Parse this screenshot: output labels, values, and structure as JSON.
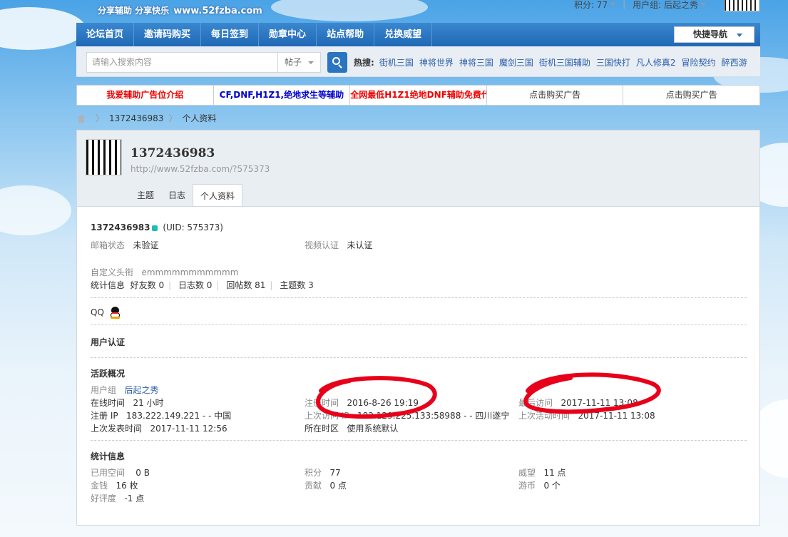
{
  "header": {
    "logo_tagline": "分享辅助  分享快乐",
    "logo_site": "www.52fzba.com",
    "points_label": "积分: 77",
    "usergroup_label": "用户组: 后起之秀"
  },
  "nav": {
    "items": [
      "论坛首页",
      "邀请码购买",
      "每日签到",
      "勋章中心",
      "站点帮助",
      "兑换威望"
    ],
    "quick_nav": "快捷导航"
  },
  "search": {
    "placeholder": "请输入搜索内容",
    "type": "帖子",
    "hot_label": "热搜:",
    "hot_keywords": [
      "街机三国",
      "神将世界",
      "神将三国",
      "魔剑三国",
      "街机三国辅助",
      "三国快打",
      "凡人修真2",
      "冒险契约",
      "醉西游"
    ]
  },
  "ads": [
    {
      "text": "我爱辅助广告位介绍",
      "style": "red"
    },
    {
      "text": "CF,DNF,H1Z1,绝地求生等辅助",
      "style": "blue"
    },
    {
      "text": "全网最低H1Z1绝地DNF辅助免费代",
      "style": "red"
    },
    {
      "text": "点击购买广告",
      "style": "plain"
    },
    {
      "text": "点击购买广告",
      "style": "plain"
    }
  ],
  "breadcrumb": {
    "user": "1372436983",
    "page": "个人资料"
  },
  "profile": {
    "username": "1372436983",
    "url": "http://www.52fzba.com/?575373",
    "tabs": [
      "主题",
      "日志",
      "个人资料"
    ],
    "active_tab": "个人资料",
    "uid_text": "(UID: 575373)",
    "email_label": "邮箱状态",
    "email_value": "未验证",
    "video_label": "视频认证",
    "video_value": "未认证",
    "custom_title_label": "自定义头衔",
    "custom_title_value": "emmmmmmmmmmm",
    "stats_label": "统计信息",
    "stats": [
      "好友数 0",
      "日志数 0",
      "回帖数 81",
      "主题数 3"
    ],
    "qq_label": "QQ",
    "user_verify_title": "用户认证",
    "activity_title": "活跃概况",
    "usergroup_label": "用户组",
    "usergroup_value": "后起之秀",
    "online_label": "在线时间",
    "online_value": "21 小时",
    "reg_time_label": "注册时间",
    "reg_time_value": "2016-8-26 19:19",
    "last_visit_label": "最后访问",
    "last_visit_value": "2017-11-11 13:08",
    "reg_ip_label": "注册 IP",
    "reg_ip_value": "183.222.149.221 - - 中国",
    "last_ip_label": "上次访问 IP",
    "last_ip_value": "182.129.225.133:58988 - - 四川遂宁",
    "last_active_label": "上次活动时间",
    "last_active_value": "2017-11-11 13:08",
    "last_post_label": "上次发表时间",
    "last_post_value": "2017-11-11 12:56",
    "timezone_label": "所在时区",
    "timezone_value": "使用系统默认",
    "stat_info_title": "统计信息",
    "space_label": "已用空间",
    "space_value": "0 B",
    "score_label": "积分",
    "score_value": "77",
    "prestige_label": "威望",
    "prestige_value": "11 点",
    "money_label": "金钱",
    "money_value": "16 枚",
    "contrib_label": "贡献",
    "contrib_value": "0 点",
    "coin_label": "游币",
    "coin_value": "0 个",
    "rating_label": "好评度",
    "rating_value": "-1 点"
  },
  "colors": {
    "nav_blue": "#2a74c0",
    "link_blue": "#2a5caa",
    "ad_red": "#ee0000",
    "annotation_red": "#e8001a"
  }
}
